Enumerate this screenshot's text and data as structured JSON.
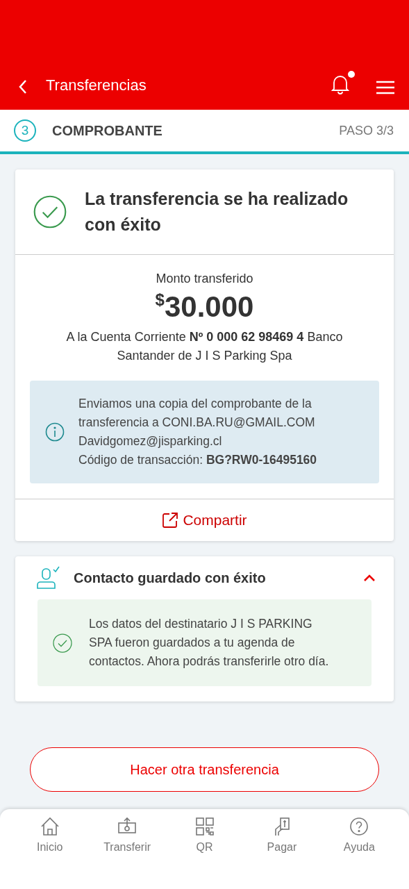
{
  "header": {
    "title": "Transferencias",
    "unread_notifications": true
  },
  "step": {
    "number": "3",
    "title": "COMPROBANTE",
    "counter": "PASO 3/3",
    "level": 1
  },
  "receipt": {
    "title": "La transferencia se ha realizado con éxito",
    "amount_label": "Monto transferido",
    "currency": "$",
    "amount": "30.000",
    "destination": "A la Cuenta Corriente **Nº 0 000 62 98469 4** Banco Santander de J I S Parking Spa",
    "info_lines": [
      "Enviamos una copia del comprobante de la transferencia a CONI.BA.RU@GMAIL.COM",
      "Davidgomez@jisparking.cl",
      "Código de transacción: **BG?RW0-16495160**"
    ],
    "share": "Compartir"
  },
  "contact": {
    "title": "Contacto guardado con éxito",
    "expanded": true,
    "message": "Los datos del destinatario J I S PARKING SPA fueron guardados a tu agenda de contactos. Ahora podrás transferirle otro día."
  },
  "action_button": "Hacer otra transferencia",
  "nav": [
    {
      "kind": "home",
      "label": "Inicio"
    },
    {
      "kind": "transfer",
      "label": "Transferir"
    },
    {
      "kind": "qr",
      "label": "QR"
    },
    {
      "kind": "pay",
      "label": "Pagar"
    },
    {
      "kind": "help",
      "label": "Ayuda"
    }
  ]
}
